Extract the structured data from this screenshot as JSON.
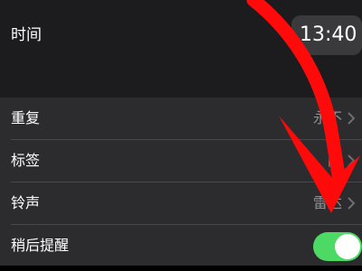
{
  "time_section": {
    "label": "时间",
    "value": "13:40"
  },
  "settings": {
    "repeat": {
      "label": "重复",
      "value": "永不"
    },
    "label": {
      "label": "标签",
      "value": "闹"
    },
    "sound": {
      "label": "铃声",
      "value": "雷达"
    },
    "snooze": {
      "label": "稍后提醒",
      "enabled": true
    }
  },
  "icons": {
    "chevron": "chevron-right-icon",
    "annotation": "red-arrow-annotation"
  },
  "colors": {
    "toggle_on": "#4cd964",
    "annotation_red": "#ff0a0a",
    "secondary_text": "#8e8e93"
  }
}
